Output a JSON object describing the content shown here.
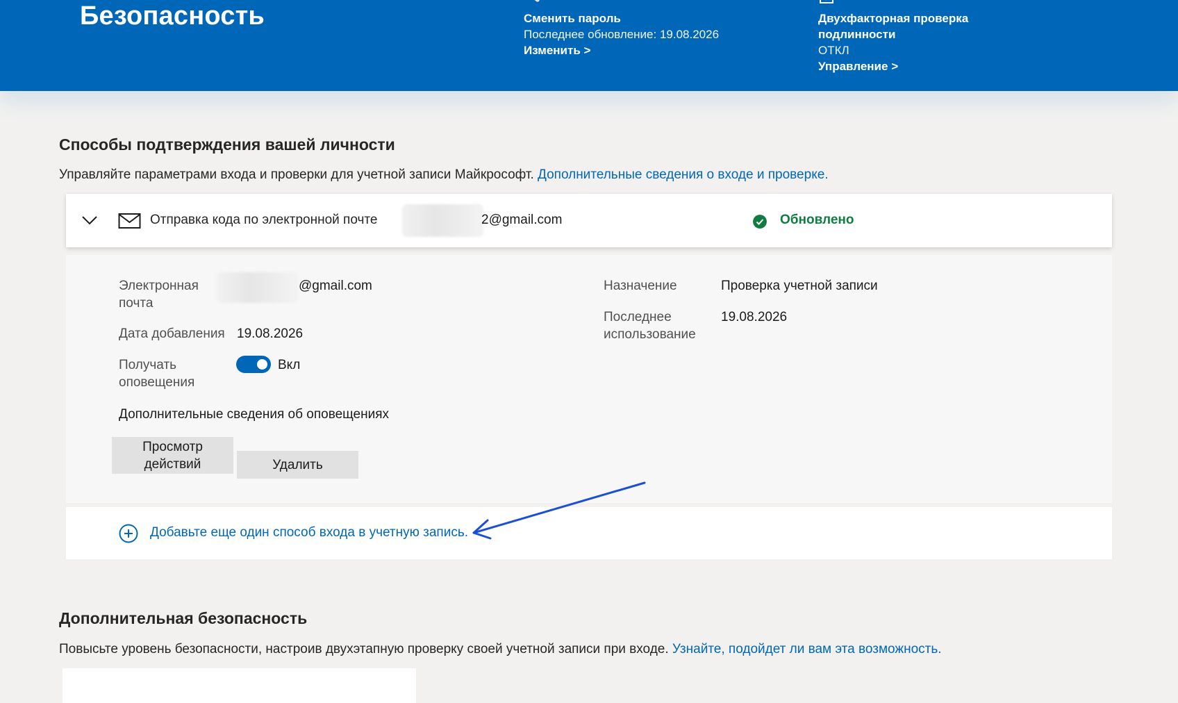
{
  "header": {
    "title": "Безопасность",
    "password_card": {
      "title": "Сменить пароль",
      "subtitle": "Последнее обновление: 19.08.2026",
      "link": "Изменить >"
    },
    "twofa_card": {
      "title_line1": "Двухфакторная проверка",
      "title_line2": "подлинности",
      "status": "ОТКЛ",
      "link": "Управление >"
    }
  },
  "verify_section": {
    "title": "Способы подтверждения вашей личности",
    "description": "Управляйте параметрами входа и проверки для учетной записи Майкрософт.",
    "description_link": "Дополнительные сведения о входе и проверке.",
    "method": {
      "label": "Отправка кода по электронной почте",
      "email_visible_suffix": "2@gmail.com",
      "status": "Обновлено",
      "status_color": "#107c41"
    },
    "details": {
      "email_label_line1": "Электронная",
      "email_label_line2": "почта",
      "email_value_suffix": "@gmail.com",
      "date_added_label": "Дата добавления",
      "date_added_value": "19.08.2026",
      "notify_label_line1": "Получать",
      "notify_label_line2": "оповещения",
      "notify_value": "Вкл",
      "notify_on": true,
      "purpose_label": "Назначение",
      "purpose_value": "Проверка учетной записи",
      "last_used_label_line1": "Последнее",
      "last_used_label_line2": "использование",
      "last_used_value": "19.08.2026",
      "notify_link": "Дополнительные сведения об оповещениях",
      "view_activity_line1": "Просмотр",
      "view_activity_line2": "действий",
      "delete_button": "Удалить"
    },
    "add_method_link": "Добавьте еще один способ входа в учетную запись."
  },
  "extra_section": {
    "title": "Дополнительная безопасность",
    "description": "Повысьте уровень безопасности, настроив двухэтапную проверку своей учетной записи при входе.",
    "description_link": "Узнайте, подойдет ли вам эта возможность."
  },
  "colors": {
    "header_bg": "#0067b8",
    "link": "#0067b8",
    "page_bg": "#f2f1f0",
    "annotation_arrow": "#1a4fd6"
  },
  "icons": [
    "key-icon",
    "checkbox-icon",
    "chevron-down-icon",
    "mail-icon",
    "check-circle-icon",
    "plus-circle-icon"
  ]
}
